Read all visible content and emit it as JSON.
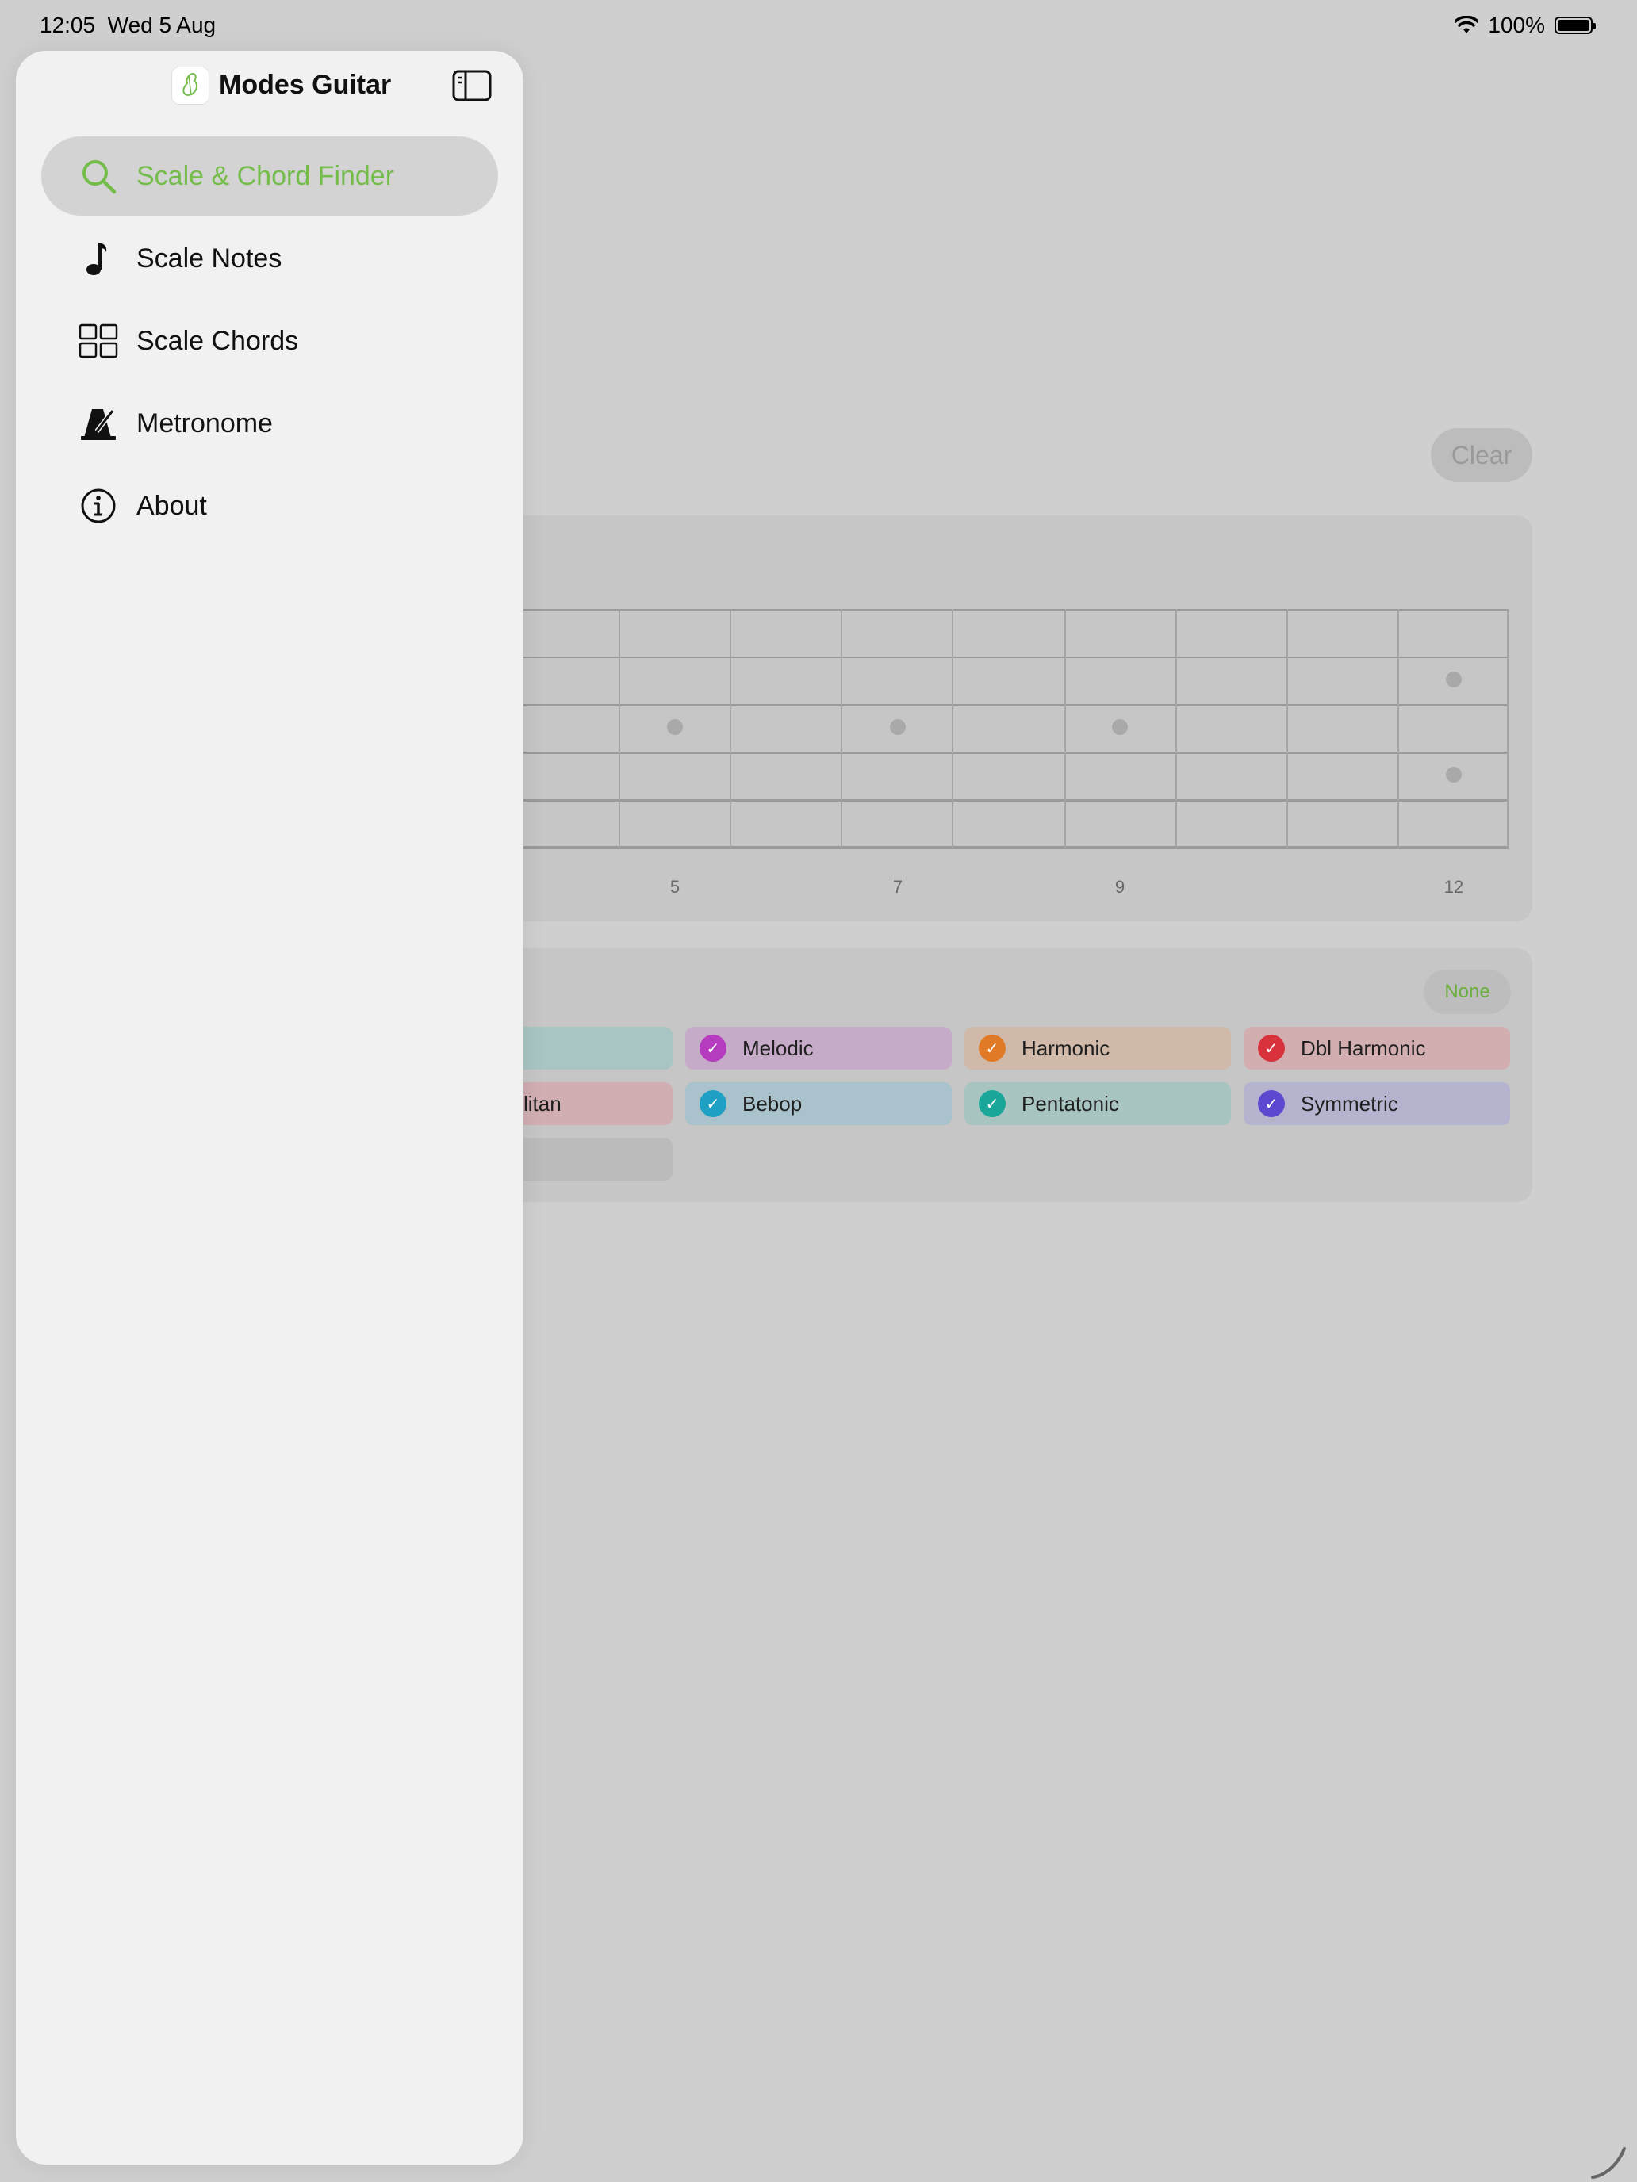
{
  "status_bar": {
    "time": "12:05",
    "date": "Wed 5 Aug",
    "battery": "100%",
    "wifi_icon": "wifi-icon",
    "battery_level": 1.0
  },
  "sidebar": {
    "app_title": "Modes Guitar",
    "app_icon": "guitar-app-icon",
    "toggle_icon": "sidebar-toggle-icon",
    "items": [
      {
        "label": "Scale & Chord Finder",
        "icon": "search-icon",
        "active": true
      },
      {
        "label": "Scale Notes",
        "icon": "music-note-icon",
        "active": false
      },
      {
        "label": "Scale Chords",
        "icon": "grid-icon",
        "active": false
      },
      {
        "label": "Metronome",
        "icon": "metronome-icon",
        "active": false
      },
      {
        "label": "About",
        "icon": "info-icon",
        "active": false
      }
    ]
  },
  "main": {
    "clear_label": "Clear",
    "fret_numbers": [
      "5",
      "7",
      "9",
      "12"
    ],
    "none_label": "None",
    "categories": [
      {
        "label": "Melodic",
        "color": "#b53cbf",
        "chip_bg": "#c6abc8"
      },
      {
        "label": "Harmonic",
        "color": "#e07a26",
        "chip_bg": "#d0b9a8"
      },
      {
        "label": "Dbl Harmonic",
        "color": "#d8323c",
        "chip_bg": "#d3aeb0"
      },
      {
        "label": "litan",
        "color": "#d8323c",
        "chip_bg": "#d0aeb2"
      },
      {
        "label": "Bebop",
        "color": "#1e9fc4",
        "chip_bg": "#a9c2cc"
      },
      {
        "label": "Pentatonic",
        "color": "#1aa698",
        "chip_bg": "#a8c4c1"
      },
      {
        "label": "Symmetric",
        "color": "#5b48cf",
        "chip_bg": "#b4b4cf"
      }
    ]
  },
  "colors": {
    "accent": "#74bd4b",
    "sidebar_bg": "#f1f1f1",
    "backdrop": "#cfcfcf"
  }
}
